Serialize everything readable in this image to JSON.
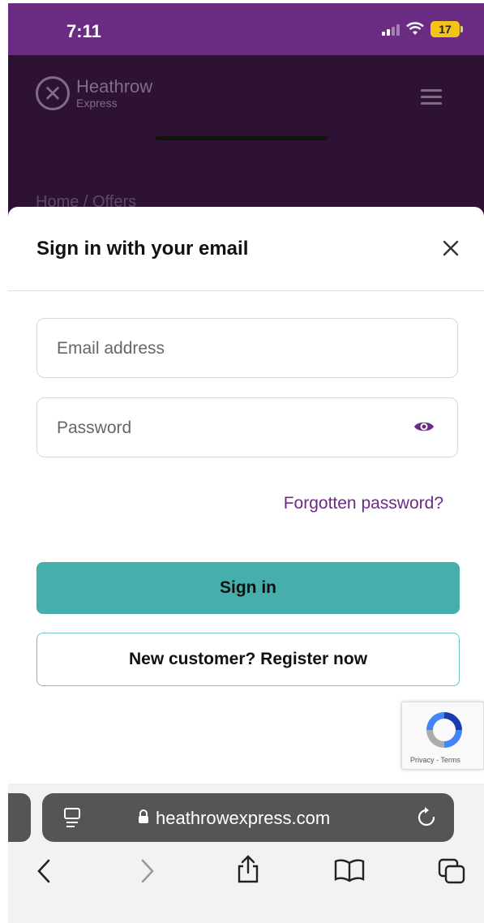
{
  "status": {
    "time": "7:11",
    "battery": "17"
  },
  "header": {
    "logo_name": "Heathrow",
    "logo_sub": "Express",
    "breadcrumb": "Home / Offers"
  },
  "modal": {
    "title": "Sign in with your email",
    "email_placeholder": "Email address",
    "password_placeholder": "Password",
    "forgot_link": "Forgotten password?",
    "signin_label": "Sign in",
    "register_label": "New customer? Register now",
    "recaptcha_text": "Privacy - Terms"
  },
  "browser": {
    "url": "heathrowexpress.com"
  },
  "colors": {
    "purple": "#6a2b82",
    "header_bg": "#2d1233",
    "teal": "#46aeab"
  },
  "icons": {
    "close": "close-icon",
    "eye": "eye-icon",
    "lock": "lock-icon",
    "reload": "reload-icon",
    "back": "chevron-left-icon",
    "forward": "chevron-right-icon",
    "share": "share-icon",
    "bookmarks": "book-icon",
    "tabs": "tabs-icon"
  }
}
